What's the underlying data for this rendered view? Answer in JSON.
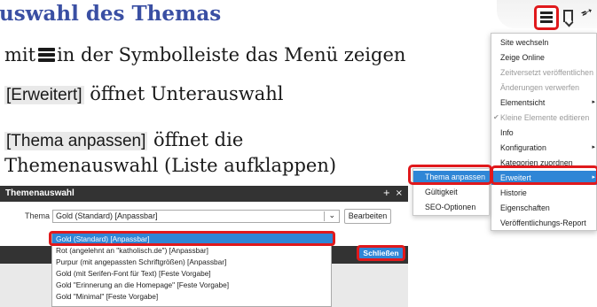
{
  "heading": "uswahl des Themas",
  "instructions": {
    "line1_pre": "mit",
    "line1_post": "in der Symbolleiste das Menü zeigen",
    "line2_key": "[Erweitert]",
    "line2_text": " öffnet Unterauswahl",
    "line3_key": "[Thema anpassen]",
    "line3_text": " öffnet die",
    "line4": "Themenauswahl (Liste aufklappen)"
  },
  "toolbar": {
    "icons": [
      "menu-icon",
      "bookmark-icon",
      "rocket-icon"
    ]
  },
  "menu": {
    "items": [
      {
        "label": "Site wechseln",
        "disabled": false
      },
      {
        "label": "Zeige Online",
        "disabled": false
      },
      {
        "label": "Zeitversetzt veröffentlichen",
        "disabled": true
      },
      {
        "label": "Änderungen verwerfen",
        "disabled": true
      },
      {
        "label": "Elementsicht",
        "disabled": false,
        "submenu": true
      },
      {
        "label": "Kleine Elemente editieren",
        "disabled": true,
        "checked": true
      },
      {
        "label": "Info",
        "disabled": false
      },
      {
        "label": "Konfiguration",
        "disabled": false,
        "submenu": true
      },
      {
        "label": "Kategorien zuordnen",
        "disabled": false
      },
      {
        "label": "Erweitert",
        "disabled": false,
        "submenu": true,
        "selected": true
      },
      {
        "label": "Historie",
        "disabled": false
      },
      {
        "label": "Eigenschaften",
        "disabled": false
      },
      {
        "label": "Veröffentlichungs-Report",
        "disabled": false
      }
    ]
  },
  "submenu": {
    "items": [
      {
        "label": "Thema anpassen",
        "selected": true
      },
      {
        "label": "Gültigkeit",
        "selected": false
      },
      {
        "label": "SEO-Optionen",
        "selected": false
      }
    ]
  },
  "dialog": {
    "title": "Themenauswahl",
    "plus": "+",
    "close_x": "×",
    "field_label": "Thema",
    "selected_value": "Gold (Standard) [Anpassbar]",
    "edit_button": "Bearbeiten",
    "close_button": "Schließen",
    "options": [
      {
        "label": "Gold (Standard) [Anpassbar]",
        "selected": true
      },
      {
        "label": "Rot (angelehnt an \"katholisch.de\") [Anpassbar]",
        "selected": false
      },
      {
        "label": "Purpur (mit angepassten Schriftgrößen) [Anpassbar]",
        "selected": false
      },
      {
        "label": "Gold (mit Serifen-Font für Text) [Feste Vorgabe]",
        "selected": false
      },
      {
        "label": "Gold \"Erinnerung an die Homepage\" [Feste Vorgabe]",
        "selected": false
      },
      {
        "label": "Gold \"Minimal\" [Feste Vorgabe]",
        "selected": false
      }
    ]
  },
  "colors": {
    "heading": "#3a4fa3",
    "highlight": "#e0191c",
    "selection": "#2f86d6",
    "dialog_header": "#333333"
  }
}
